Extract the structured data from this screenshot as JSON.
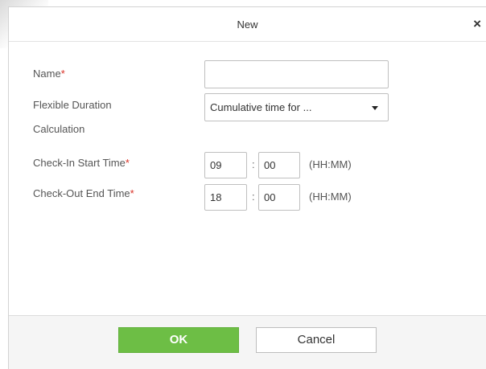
{
  "dialog": {
    "title": "New",
    "close_symbol": "×"
  },
  "form": {
    "name_label": "Name",
    "required_mark": "*",
    "name_value": "",
    "flex_label_line1": "Flexible Duration",
    "flex_label_line2": "Calculation",
    "flex_selected": "Cumulative time for ...",
    "checkin_label": "Check-In Start Time",
    "checkin_hour": "09",
    "checkin_minute": "00",
    "checkout_label": "Check-Out End Time",
    "checkout_hour": "18",
    "checkout_minute": "00",
    "time_separator": ":",
    "time_format_hint": "(HH:MM)"
  },
  "footer": {
    "ok_label": "OK",
    "cancel_label": "Cancel"
  },
  "icons": {
    "close": "close-icon",
    "dropdown": "caret-down-icon"
  },
  "colors": {
    "ok_button": "#6dbe45",
    "required": "#d93025"
  }
}
